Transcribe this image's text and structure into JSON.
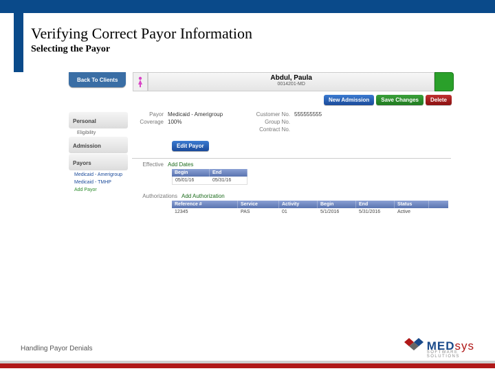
{
  "slide": {
    "title": "Verifying Correct Payor Information",
    "subtitle": "Selecting the Payor",
    "footer_label": "Handling Payor Denials"
  },
  "logo": {
    "part1": "MED",
    "part2": "sys",
    "tagline": "SOFTWARE SOLUTIONS"
  },
  "app": {
    "back_label": "Back To Clients",
    "client_name": "Abdul, Paula",
    "client_id": "0014201-MD",
    "actions": {
      "new_admission": "New Admission",
      "save": "Save Changes",
      "delete": "Delete"
    },
    "sidebar": {
      "personal": "Personal",
      "eligibility": "Eligibility",
      "admission": "Admission",
      "payors": "Payors",
      "payor_links": [
        "Medicaid - Amerigroup",
        "Medicaid - TMHP"
      ],
      "add_payor": "Add Payor"
    },
    "info": {
      "payor_label": "Payor",
      "payor_value": "Medicaid - Amerigroup",
      "coverage_label": "Coverage",
      "coverage_value": "100%",
      "customer_no_label": "Customer No.",
      "customer_no_value": "555555555",
      "group_no_label": "Group No.",
      "group_no_value": "",
      "contract_no_label": "Contract No.",
      "contract_no_value": "",
      "edit_payor": "Edit Payor"
    },
    "effective": {
      "label": "Effective",
      "add_link": "Add Dates",
      "cols": {
        "begin": "Begin",
        "end": "End"
      },
      "row": {
        "begin": "05/01/16",
        "end": "05/31/16"
      }
    },
    "auth": {
      "label": "Authorizations",
      "add_link": "Add Authorization",
      "cols": {
        "ref": "Reference #",
        "service": "Service",
        "activity": "Activity",
        "begin": "Begin",
        "end": "End",
        "status": "Status"
      },
      "row": {
        "ref": "12345",
        "service": "PAS",
        "activity": "01",
        "begin": "5/1/2016",
        "end": "5/31/2016",
        "status": "Active"
      }
    }
  }
}
